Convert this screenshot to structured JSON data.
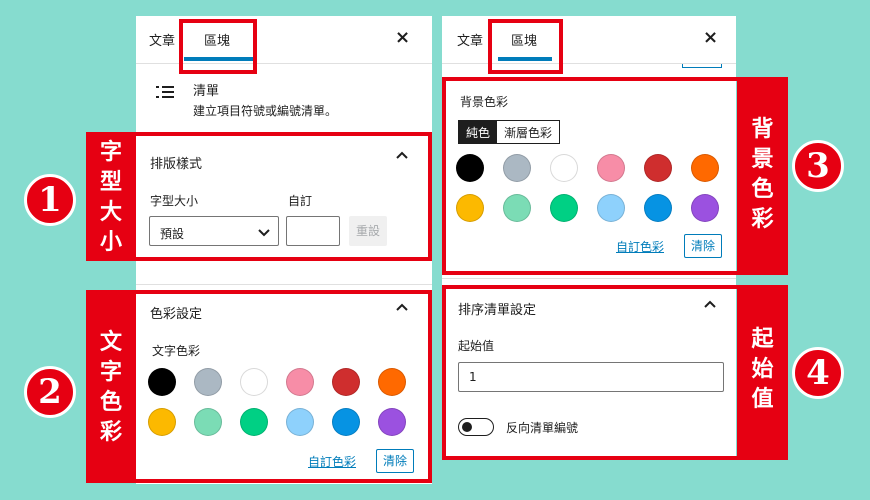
{
  "tabs": {
    "post": "文章",
    "block": "區塊",
    "close": "×"
  },
  "block_card": {
    "icon": "list-icon",
    "title": "清單",
    "desc": "建立項目符號或編號清單。"
  },
  "typography": {
    "title": "排版樣式",
    "size_label": "字型大小",
    "custom_label": "自訂",
    "select_value": "預設",
    "reset": "重設"
  },
  "text_color": {
    "title": "色彩設定",
    "label": "文字色彩",
    "custom": "自訂色彩",
    "clear": "清除"
  },
  "bg_color": {
    "label": "背景色彩",
    "solid": "純色",
    "gradient": "漸層色彩",
    "custom": "自訂色彩",
    "clear": "清除"
  },
  "ordered": {
    "title": "排序清單設定",
    "start_label": "起始值",
    "start_value": "1",
    "reverse_label": "反向清單編號"
  },
  "palette": [
    "#000000",
    "#abb8c3",
    "#ffffff",
    "#f78da7",
    "#cf2e2e",
    "#ff6900",
    "#fcb900",
    "#7bdcb5",
    "#00d084",
    "#8ed1fc",
    "#0693e3",
    "#9b51e0"
  ],
  "annotations": {
    "a1": {
      "num": "1",
      "chars": [
        "字",
        "型",
        "大",
        "小"
      ]
    },
    "a2": {
      "num": "2",
      "chars": [
        "文",
        "字",
        "色",
        "彩"
      ]
    },
    "a3": {
      "num": "3",
      "chars": [
        "背",
        "景",
        "色",
        "彩"
      ]
    },
    "a4": {
      "num": "4",
      "chars": [
        "起",
        "始",
        "值"
      ]
    }
  }
}
